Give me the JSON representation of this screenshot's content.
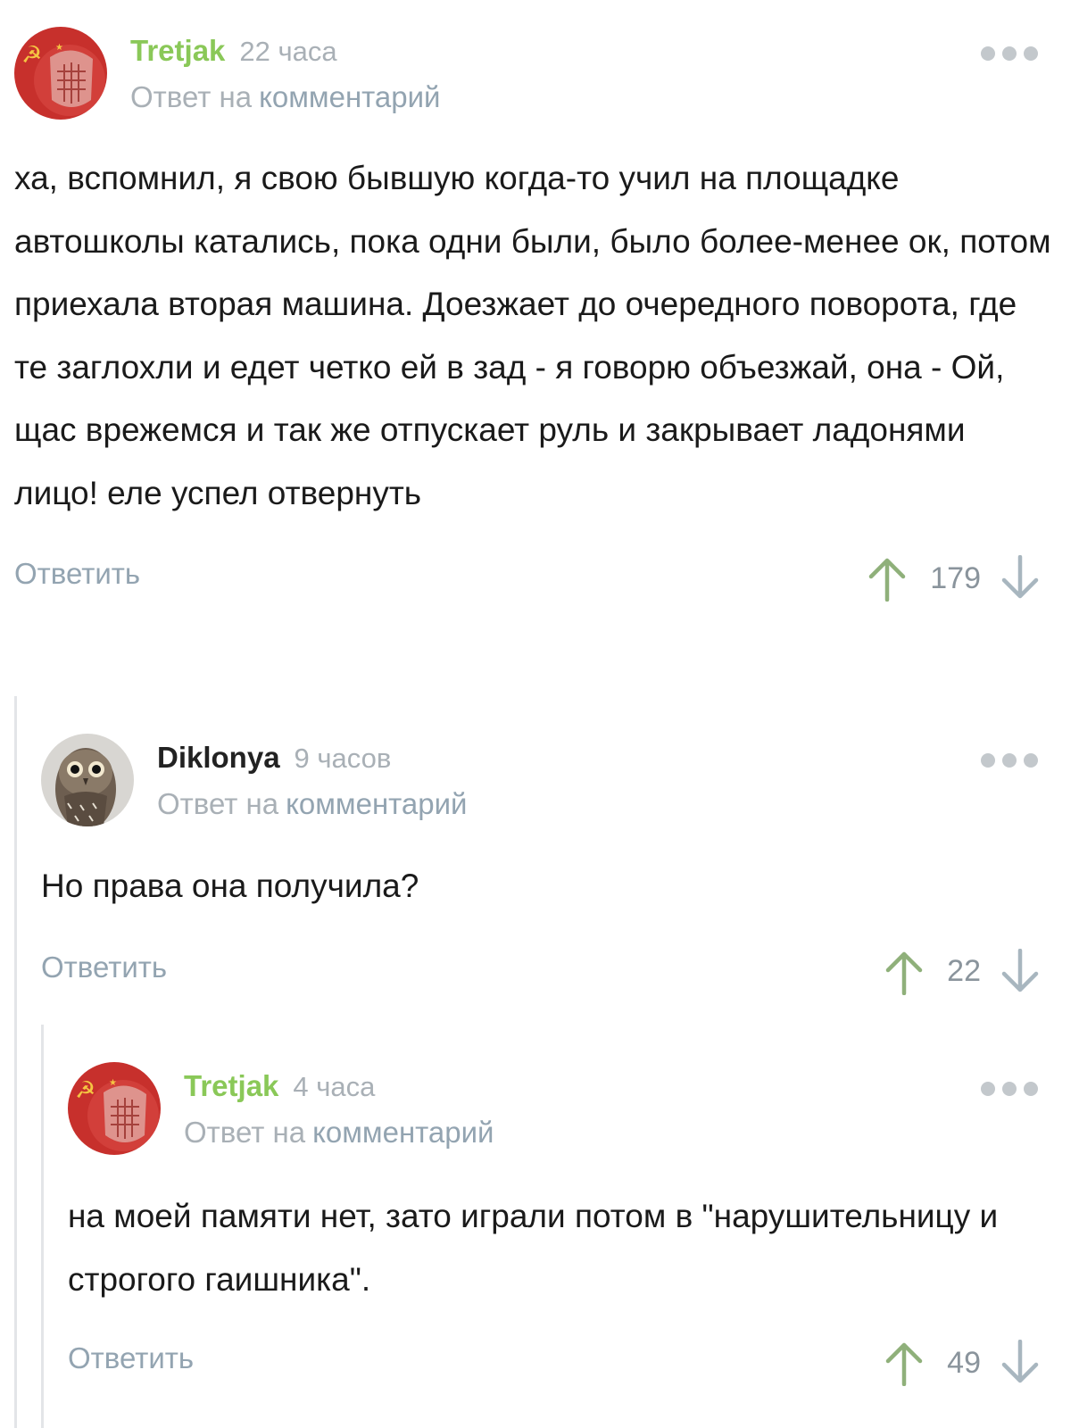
{
  "comments": [
    {
      "author": "Tretjak",
      "time": "22 часа",
      "reply_prefix": "Ответ на",
      "reply_link": "комментарий",
      "text": "ха, вспомнил, я свою бывшую когда-то учил на площадке автошколы катались, пока одни были, было более-менее ок, потом приехала вторая машина. Доезжает до очередного поворота, где те заглохли и едет четко ей в зад - я говорю объезжай, она - Ой, щас врежемся и так же отпускает руль и закрывает ладонями лицо! еле успел отвернуть",
      "reply_button": "Ответить",
      "rating": "179",
      "avatar_icon": "hockey-mask-hammer-sickle-avatar"
    },
    {
      "author": "Diklonya",
      "time": "9 часов",
      "reply_prefix": "Ответ на",
      "reply_link": "комментарий",
      "text": "Но права она получила?",
      "reply_button": "Ответить",
      "rating": "22",
      "avatar_icon": "owl-avatar"
    },
    {
      "author": "Tretjak",
      "time": "4 часа",
      "reply_prefix": "Ответ на",
      "reply_link": "комментарий",
      "text": "на моей памяти нет, зато играли потом в \"нарушительницу и строгого гаишника\".",
      "reply_button": "Ответить",
      "rating": "49",
      "avatar_icon": "hockey-mask-hammer-sickle-avatar"
    }
  ],
  "colors": {
    "author_green": "#8ac858",
    "meta_gray": "#a9b0b6",
    "link_blue_gray": "#93a4b1",
    "thread_line": "#e3e5e8",
    "arrow_green": "#8fb07a",
    "arrow_gray": "#a8b6bf"
  },
  "icons": {
    "upvote": "arrow-up-icon",
    "downvote": "arrow-down-icon",
    "more": "more-dots-icon"
  }
}
